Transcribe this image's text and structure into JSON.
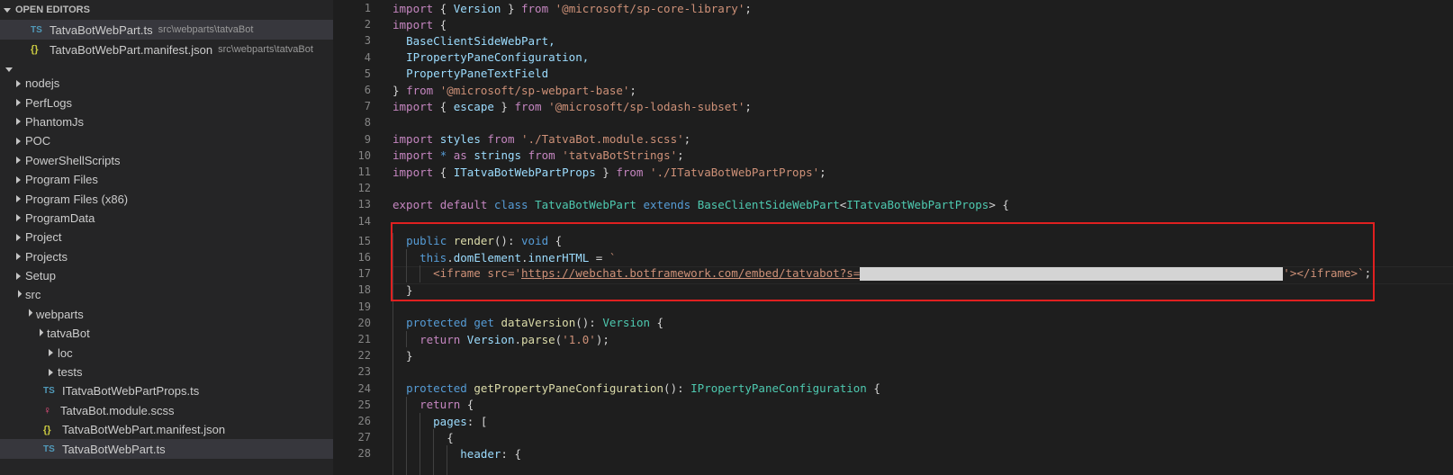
{
  "sidebar": {
    "open_editors_title": "OPEN EDITORS",
    "open_editors": [
      {
        "icon": "TS",
        "name": "TatvaBotWebPart.ts",
        "path": "src\\webparts\\tatvaBot"
      },
      {
        "icon": "{}",
        "name": "TatvaBotWebPart.manifest.json",
        "path": "src\\webparts\\tatvaBot"
      }
    ],
    "tree": [
      {
        "label": "nodejs"
      },
      {
        "label": "PerfLogs"
      },
      {
        "label": "PhantomJs"
      },
      {
        "label": "POC"
      },
      {
        "label": "PowerShellScripts"
      },
      {
        "label": "Program Files"
      },
      {
        "label": "Program Files (x86)"
      },
      {
        "label": "ProgramData"
      },
      {
        "label": "Project"
      },
      {
        "label": "Projects"
      },
      {
        "label": "Setup"
      },
      {
        "label": "src"
      },
      {
        "label": "webparts"
      },
      {
        "label": "tatvaBot"
      },
      {
        "label": "loc"
      },
      {
        "label": "tests"
      },
      {
        "label": "ITatvaBotWebPartProps.ts",
        "icon": "TS"
      },
      {
        "label": "TatvaBot.module.scss",
        "icon": "scss"
      },
      {
        "label": "TatvaBotWebPart.manifest.json",
        "icon": "{}"
      },
      {
        "label": "TatvaBotWebPart.ts",
        "icon": "TS"
      }
    ]
  },
  "editor": {
    "line_numbers": [
      "1",
      "2",
      "3",
      "4",
      "5",
      "6",
      "7",
      "8",
      "9",
      "10",
      "11",
      "12",
      "13",
      "14",
      "15",
      "16",
      "17",
      "18",
      "19",
      "20",
      "21",
      "22",
      "23",
      "24",
      "25",
      "26",
      "27",
      "28"
    ],
    "tokens": {
      "import": "import",
      "from": "from",
      "Version": "Version",
      "sp_core": "'@microsoft/sp-core-library'",
      "BaseClientSideWebPart": "BaseClientSideWebPart,",
      "IPropertyPaneConfiguration": "IPropertyPaneConfiguration,",
      "PropertyPaneTextField": "PropertyPaneTextField",
      "sp_webpart_base": "'@microsoft/sp-webpart-base'",
      "escape": "escape",
      "sp_lodash": "'@microsoft/sp-lodash-subset'",
      "styles": "styles",
      "styles_path": "'./TatvaBot.module.scss'",
      "as": "as",
      "strings": "strings",
      "strings_path": "'tatvaBotStrings'",
      "props": "ITatvaBotWebPartProps",
      "props_path": "'./ITatvaBotWebPartProps'",
      "export": "export",
      "default": "default",
      "class": "class",
      "class_name": "TatvaBotWebPart",
      "extends": "extends",
      "base_class": "BaseClientSideWebPart",
      "public": "public",
      "render": "render",
      "void": "void",
      "this": "this",
      "domElement": "domElement",
      "innerHTML": "innerHTML",
      "iframe_open": "<iframe src='",
      "iframe_url": "https://webchat.botframework.com/embed/tatvabot?s=",
      "iframe_close": "'></iframe>`",
      "protected": "protected",
      "get": "get",
      "dataVersion": "dataVersion",
      "return": "return",
      "parse": "parse",
      "version_str": "'1.0'",
      "getPropertyPaneConfiguration": "getPropertyPaneConfiguration",
      "IPropertyPaneConfiguration_t": "IPropertyPaneConfiguration",
      "pages": "pages",
      "header": "header"
    }
  },
  "colors": {
    "keyword": "#c586c0",
    "keyword2": "#569cd6",
    "string": "#ce9178",
    "type": "#4ec9b0",
    "function": "#dcdcaa",
    "identifier": "#9cdcfe",
    "highlight_box": "#e02020"
  }
}
